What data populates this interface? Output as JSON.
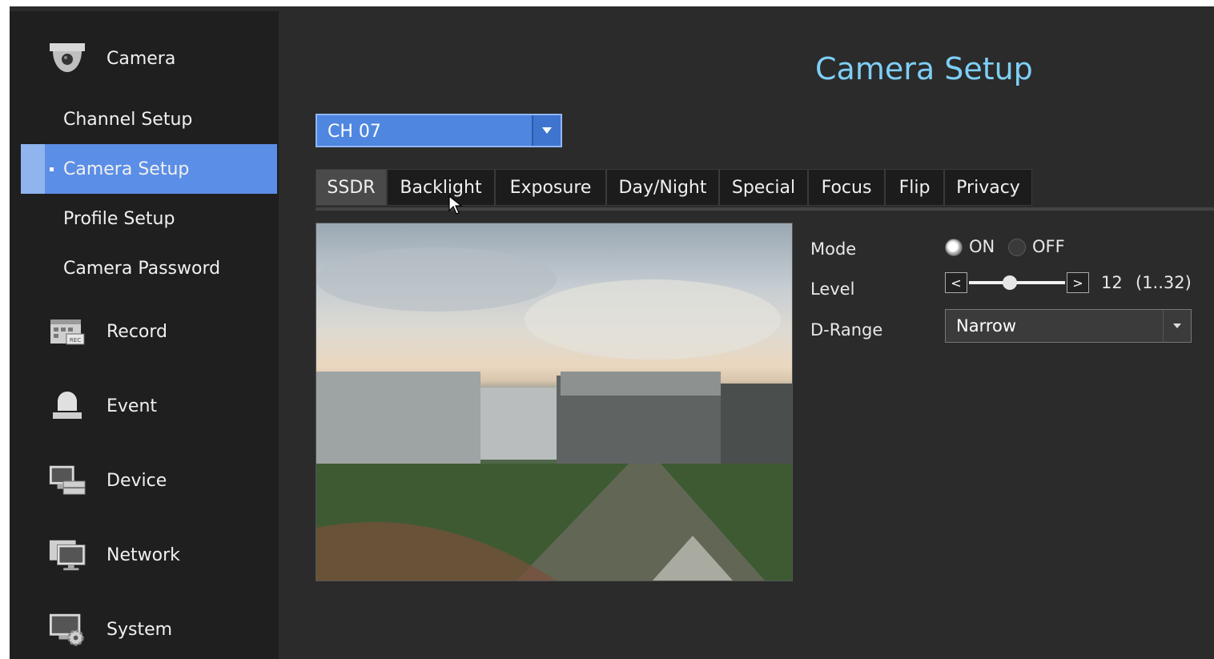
{
  "sidebar": {
    "main": [
      {
        "label": "Camera",
        "icon": "camera-icon"
      },
      {
        "label": "Record",
        "icon": "record-icon"
      },
      {
        "label": "Event",
        "icon": "event-icon"
      },
      {
        "label": "Device",
        "icon": "device-icon"
      },
      {
        "label": "Network",
        "icon": "network-icon"
      },
      {
        "label": "System",
        "icon": "system-icon"
      }
    ],
    "camera_sub": [
      {
        "label": "Channel Setup"
      },
      {
        "label": "Camera Setup",
        "active": true
      },
      {
        "label": "Profile Setup"
      },
      {
        "label": "Camera Password"
      }
    ]
  },
  "header": {
    "title": "Camera Setup"
  },
  "channel": {
    "value": "CH 07"
  },
  "tabs": [
    {
      "label": "SSDR",
      "active": true
    },
    {
      "label": "Backlight"
    },
    {
      "label": "Exposure"
    },
    {
      "label": "Day/Night"
    },
    {
      "label": "Special"
    },
    {
      "label": "Focus"
    },
    {
      "label": "Flip"
    },
    {
      "label": "Privacy"
    }
  ],
  "settings": {
    "mode": {
      "label": "Mode",
      "on": "ON",
      "off": "OFF",
      "selected": "ON"
    },
    "level": {
      "label": "Level",
      "value": "12",
      "range": "(1..32)",
      "dec": "<",
      "inc": ">",
      "min": 1,
      "max": 32,
      "current": 12
    },
    "drange": {
      "label": "D-Range",
      "value": "Narrow"
    }
  },
  "colors": {
    "accent": "#5b8ee6",
    "title": "#7ecff5",
    "background": "#2b2b2b"
  }
}
